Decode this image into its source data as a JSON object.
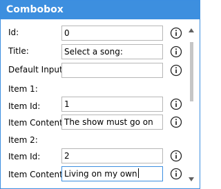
{
  "window": {
    "title": "Combobox"
  },
  "icons": {
    "info": "info-circle-icon",
    "scroll_up": "triangle-up-icon",
    "scroll_down": "triangle-down-icon"
  },
  "colors": {
    "accent": "#3d8fdf",
    "field_border": "#b6b6b6",
    "scrollbar_thumb": "#c6c6c6"
  },
  "form": {
    "id": {
      "label": "Id:",
      "value": "0"
    },
    "title": {
      "label": "Title:",
      "value": "Select a song:"
    },
    "default_input": {
      "label": "Default Input:",
      "value": ""
    },
    "item1": {
      "header": "Item 1:",
      "id_label": "Item Id:",
      "id_value": "1",
      "content_label": "Item Content:",
      "content_value": "The show must go on"
    },
    "item2": {
      "header": "Item 2:",
      "id_label": "Item Id:",
      "id_value": "2",
      "content_label": "Item Content:",
      "content_value": "Living on my own"
    }
  }
}
